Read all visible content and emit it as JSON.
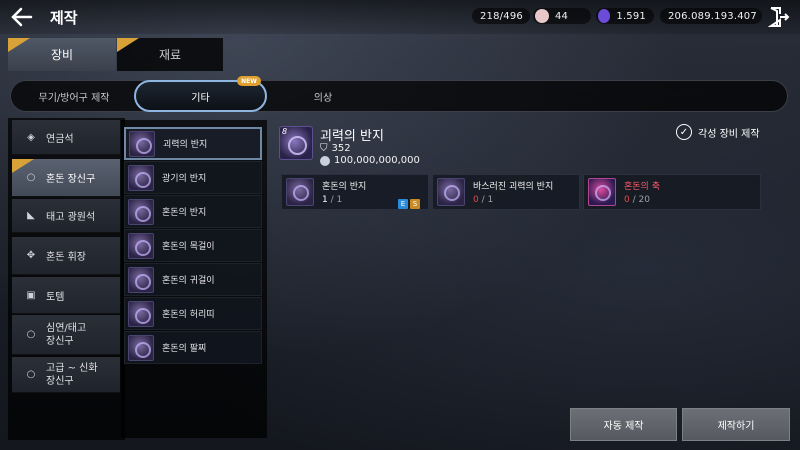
{
  "header": {
    "title": "제작",
    "currencies": [
      {
        "icon": "inventory-icon",
        "value": "218/496",
        "color": "#8db54e"
      },
      {
        "icon": "pearl-icon",
        "value": "44",
        "color": "#e7c7c7"
      },
      {
        "icon": "energy-icon",
        "value": "1.591",
        "color": "#6b4bd8"
      },
      {
        "icon": "silver-icon",
        "value": "206.089.193.407",
        "color": "#c9d2dc"
      }
    ]
  },
  "main_tabs": [
    {
      "label": "장비",
      "active": true,
      "new": true
    },
    {
      "label": "재료",
      "active": false,
      "new": true
    }
  ],
  "sub_tabs": [
    {
      "label": "무기/방어구 제작"
    },
    {
      "label": "기타",
      "active": true,
      "badge": "NEW"
    },
    {
      "label": "의상"
    }
  ],
  "categories": [
    {
      "label": "연금석",
      "icon": "alchemy-stone-icon"
    },
    {
      "label": "혼돈 장신구",
      "icon": "ring-icon",
      "active": true,
      "new": true
    },
    {
      "label": "태고 광원석",
      "icon": "crystal-icon"
    },
    {
      "label": "혼돈 휘장",
      "icon": "emblem-icon"
    },
    {
      "label": "토템",
      "icon": "totem-icon"
    },
    {
      "label": "심연/태고\n장신구",
      "icon": "ring-icon"
    },
    {
      "label": "고급 ~ 신화\n장신구",
      "icon": "ring-icon"
    }
  ],
  "items": [
    {
      "label": "괴력의 반지",
      "active": true
    },
    {
      "label": "광기의 반지"
    },
    {
      "label": "혼돈의 반지"
    },
    {
      "label": "혼돈의 목걸이"
    },
    {
      "label": "혼돈의 귀걸이"
    },
    {
      "label": "혼돈의 허리띠"
    },
    {
      "label": "혼돈의 팔찌"
    }
  ],
  "detail": {
    "level": "8",
    "name": "괴력의 반지",
    "shield": "352",
    "cost": "100,000,000,000",
    "awaken_label": "각성 장비 제작"
  },
  "materials": [
    {
      "name": "혼돈의 반지",
      "have": "1",
      "need": "/ 1",
      "level": "8",
      "tags": [
        "E",
        "S"
      ]
    },
    {
      "name": "바스러진 괴력의 반지",
      "have": "0",
      "need": "/ 1"
    },
    {
      "name": "혼돈의 축",
      "have": "0",
      "need": "/ 20"
    }
  ],
  "buttons": {
    "auto": "자동 제작",
    "craft": "제작하기"
  }
}
